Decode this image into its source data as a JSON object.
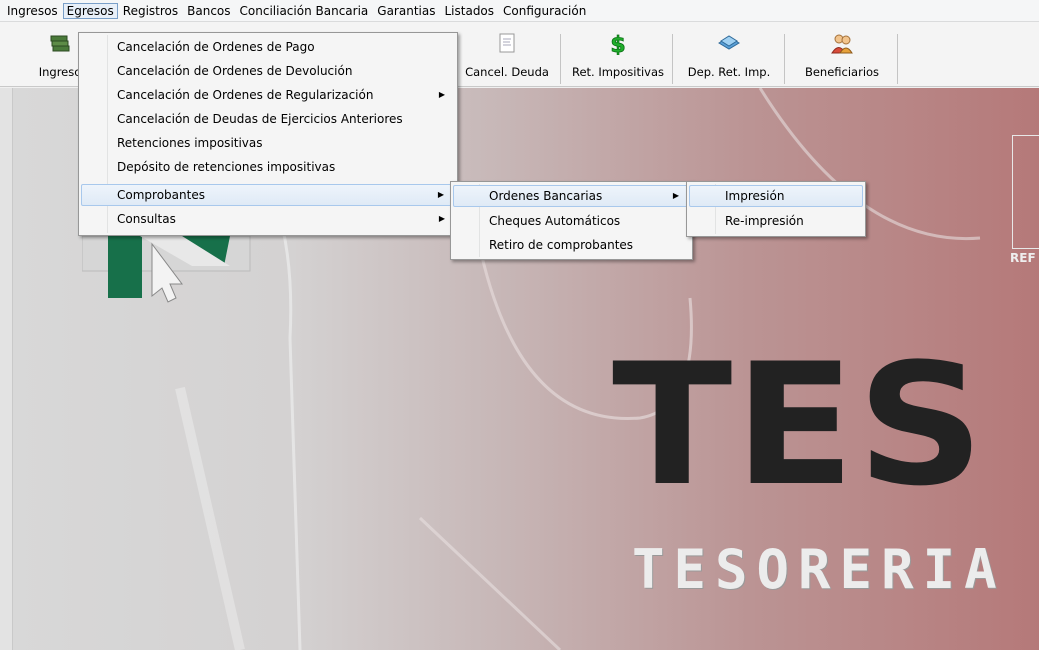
{
  "menubar": {
    "items": [
      "Ingresos",
      "Egresos",
      "Registros",
      "Bancos",
      "Conciliación Bancaria",
      "Garantias",
      "Listados",
      "Configuración"
    ]
  },
  "toolbar": {
    "buttons": [
      {
        "label": "Ingreso",
        "icon": "money-stack-icon"
      },
      {
        "label": "Cancel. Deuda",
        "icon": "document-icon"
      },
      {
        "label": "Ret. Impositivas",
        "icon": "dollar-icon"
      },
      {
        "label": "Dep. Ret. Imp.",
        "icon": "deposit-icon"
      },
      {
        "label": "Beneficiarios",
        "icon": "people-icon"
      }
    ]
  },
  "egresos_menu": {
    "items": [
      {
        "label": "Cancelación de Ordenes de Pago"
      },
      {
        "label": "Cancelación de Ordenes de Devolución"
      },
      {
        "label": "Cancelación de Ordenes de Regularización"
      },
      {
        "label": "Cancelación de Deudas de Ejercicios Anteriores"
      },
      {
        "label": "Retenciones impositivas"
      },
      {
        "label": "Depósito de retenciones impositivas"
      },
      {
        "label": "Comprobantes"
      },
      {
        "label": "Consultas"
      }
    ]
  },
  "comprobantes_menu": {
    "items": [
      {
        "label": "Ordenes Bancarias"
      },
      {
        "label": "Cheques Automáticos"
      },
      {
        "label": "Retiro de comprobantes"
      }
    ]
  },
  "ordenes_menu": {
    "items": [
      {
        "label": "Impresión"
      },
      {
        "label": "Re-impresión"
      }
    ]
  },
  "background": {
    "logo_big": "TES",
    "logo_small": "TESORERIA",
    "side_text": "REF"
  },
  "colors": {
    "highlight": "#dfeaf6",
    "highlight_border": "#a8c8ec",
    "logo_dark": "#222222",
    "bg_red": "#b57979"
  }
}
